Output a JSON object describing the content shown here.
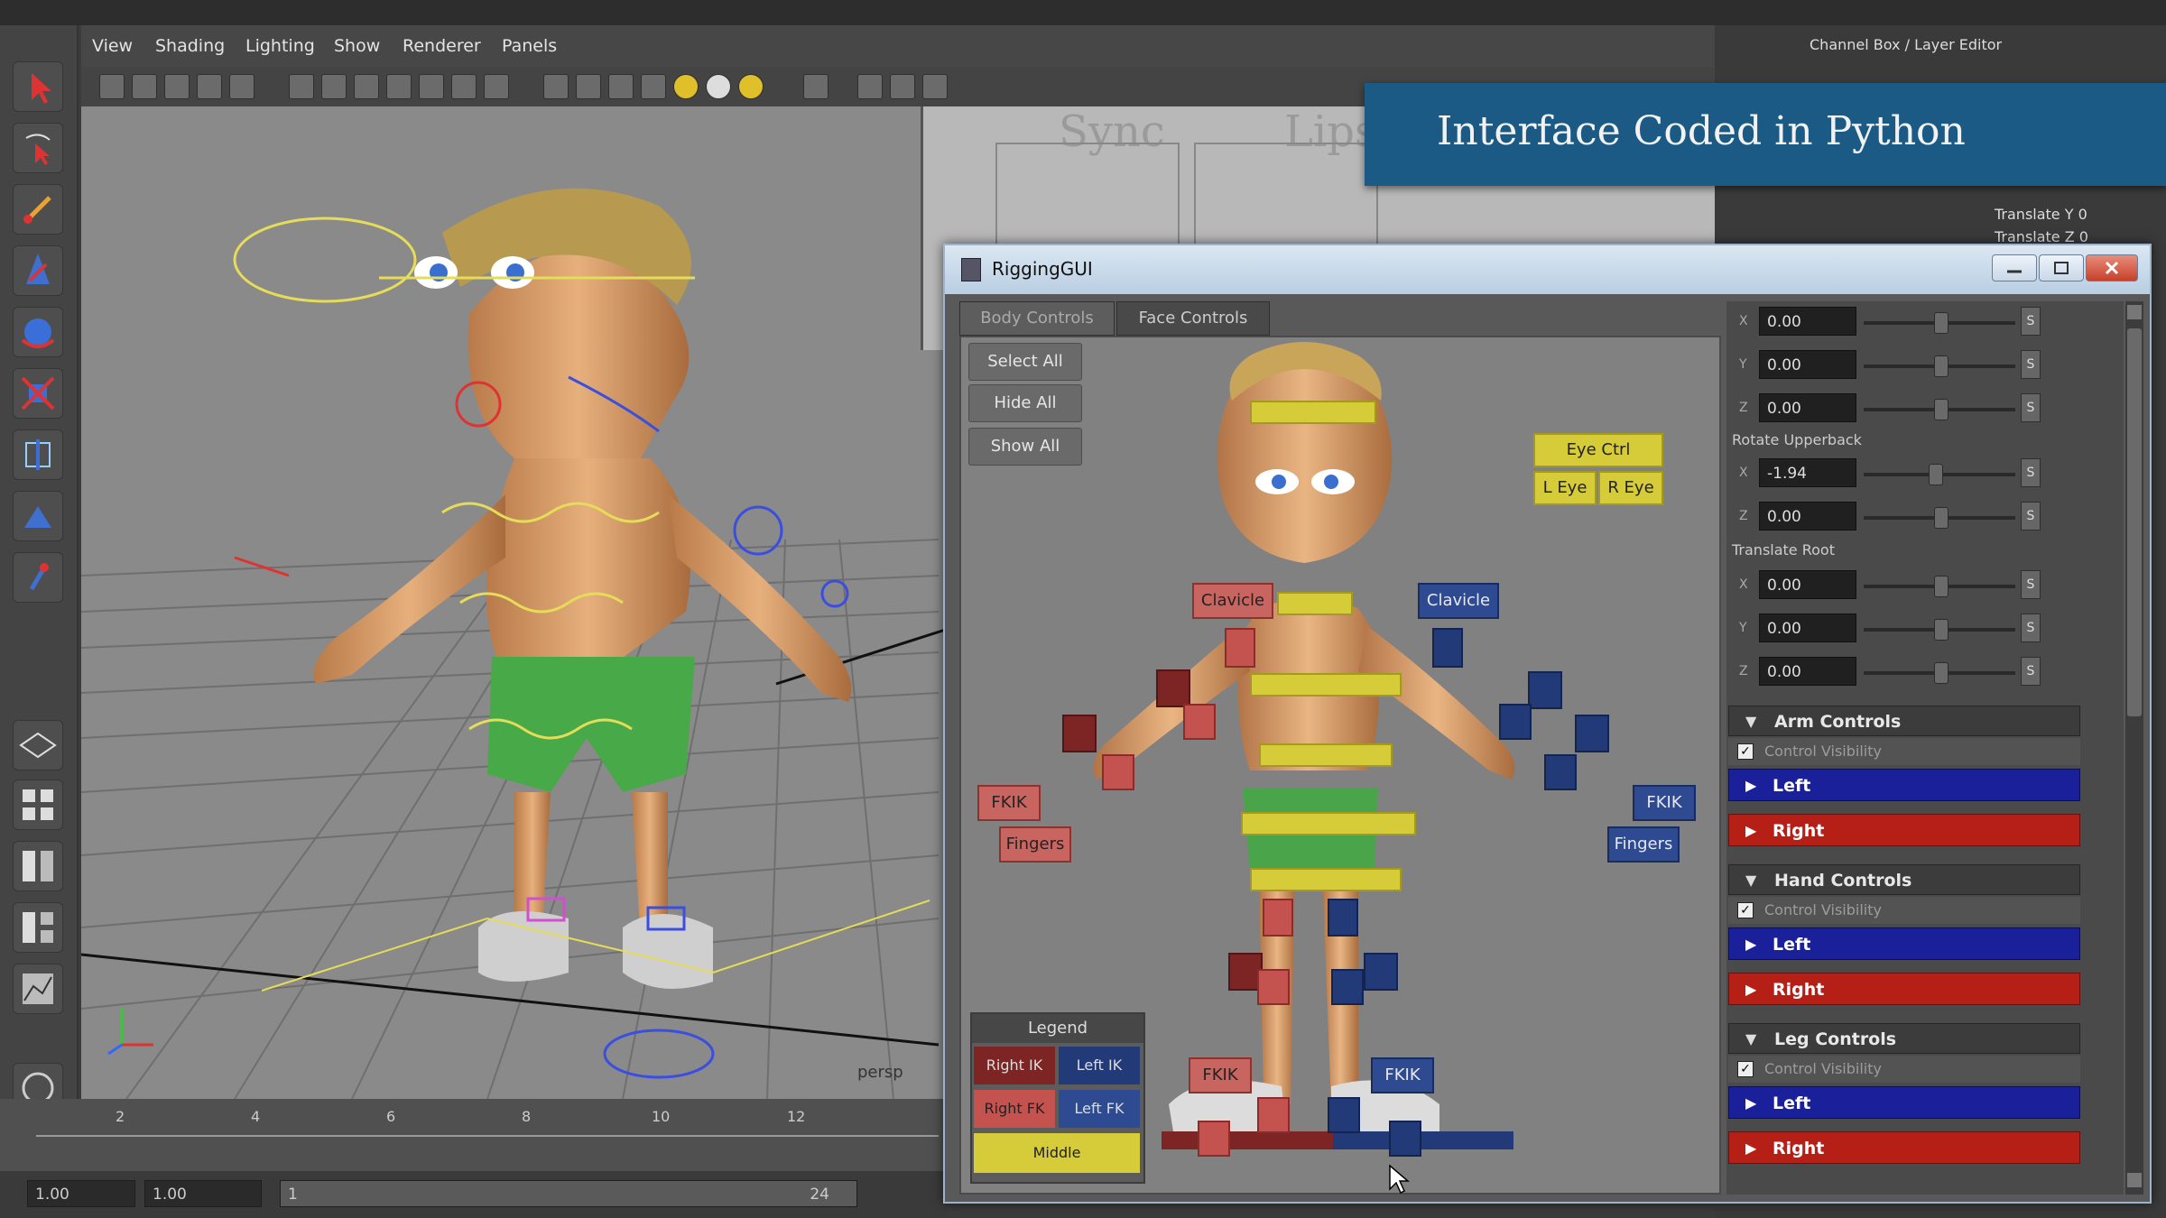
{
  "viewport_menu": [
    "View",
    "Shading",
    "Lighting",
    "Show",
    "Renderer",
    "Panels"
  ],
  "viewport_label": "persp",
  "channel_box_title": "Channel Box / Layer Editor",
  "channel_box_rows": [
    "Translate Y 0",
    "Translate Z 0"
  ],
  "background_panel_text": [
    "Sync",
    "Lips"
  ],
  "banner": {
    "text": "Interface Coded in Python"
  },
  "timeline": {
    "ticks": [
      "2",
      "4",
      "6",
      "8",
      "10",
      "12"
    ],
    "start": "1.00",
    "start2": "1.00",
    "range_start": "1",
    "range_end": "24"
  },
  "window": {
    "title": "RiggingGUI"
  },
  "tabs": [
    {
      "label": "Body Controls"
    },
    {
      "label": "Face Controls"
    }
  ],
  "buttons": {
    "select_all": "Select All",
    "hide_all": "Hide All",
    "show_all": "Show All"
  },
  "eye_ctrls": {
    "eye": "Eye Ctrl",
    "left": "L Eye",
    "right": "R Eye"
  },
  "body_labels": {
    "clavicle_r": "Clavicle",
    "clavicle_l": "Clavicle",
    "fkik_r": "FKIK",
    "fkik_l": "FKIK",
    "fingers_r": "Fingers",
    "fingers_l": "Fingers",
    "foot_fkik_r": "FKIK",
    "foot_fkik_l": "FKIK"
  },
  "legend": {
    "title": "Legend",
    "right_ik": "Right IK",
    "left_ik": "Left IK",
    "right_fk": "Right FK",
    "left_fk": "Left FK",
    "middle": "Middle"
  },
  "attributes": {
    "group1": [
      {
        "axis": "X",
        "value": "0.00"
      },
      {
        "axis": "Y",
        "value": "0.00"
      },
      {
        "axis": "Z",
        "value": "0.00"
      }
    ],
    "rotate_upperback_label": "Rotate Upperback",
    "group2": [
      {
        "axis": "X",
        "value": "-1.94"
      },
      {
        "axis": "Z",
        "value": "0.00"
      }
    ],
    "translate_root_label": "Translate Root",
    "group3": [
      {
        "axis": "X",
        "value": "0.00"
      },
      {
        "axis": "Y",
        "value": "0.00"
      },
      {
        "axis": "Z",
        "value": "0.00"
      }
    ]
  },
  "sections": [
    {
      "title": "Arm Controls",
      "visibility": "Control Visibility",
      "left": "Left",
      "right": "Right"
    },
    {
      "title": "Hand Controls",
      "visibility": "Control Visibility",
      "left": "Left",
      "right": "Right"
    },
    {
      "title": "Leg Controls",
      "visibility": "Control Visibility",
      "left": "Left",
      "right": "Right"
    }
  ],
  "colors": {
    "banner": "#1b5a85",
    "left_blue": "#1a1f9a",
    "right_red": "#b61f16",
    "middle_yellow": "#d6cc3a"
  }
}
